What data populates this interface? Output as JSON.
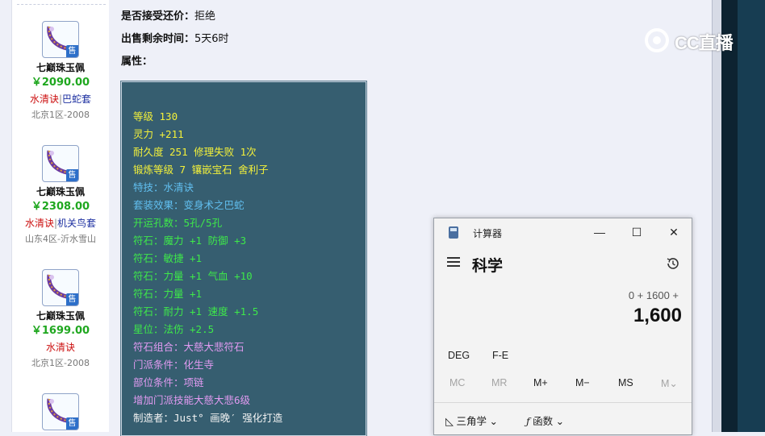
{
  "sidebar": {
    "items": [
      {
        "name": "七巅珠玉佩",
        "price": "￥2090.00",
        "tag1": "水清诀",
        "sep": "|",
        "tag2": "巴蛇套",
        "server": "北京1区-2008",
        "sell_badge": "售"
      },
      {
        "name": "七巅珠玉佩",
        "price": "￥2308.00",
        "tag1": "水清诀",
        "sep": "|",
        "tag2": "机关鸟套",
        "server": "山东4区-沂水雪山",
        "sell_badge": "售"
      },
      {
        "name": "七巅珠玉佩",
        "price": "￥1699.00",
        "tag1": "水清诀",
        "sep": "",
        "tag2": "",
        "server": "北京1区-2008",
        "sell_badge": "售"
      },
      {
        "name": "",
        "price": "",
        "tag1": "",
        "sep": "",
        "tag2": "",
        "server": "",
        "sell_badge": "售"
      }
    ]
  },
  "detail": {
    "bargain_label": "是否接受还价：",
    "bargain_value": "拒绝",
    "remaining_label": "出售剩余时间：",
    "remaining_value": "5天6时",
    "attr_label": "属性："
  },
  "attributes": [
    {
      "text": "等级 130",
      "color": "yellow"
    },
    {
      "text": "灵力 +211",
      "color": "yellow"
    },
    {
      "text": "耐久度 251 修理失败 1次",
      "color": "yellow"
    },
    {
      "text": "锻炼等级 7 镶嵌宝石 舍利子",
      "color": "yellow"
    },
    {
      "text": "特技：水清诀",
      "color": "blue"
    },
    {
      "text": "套装效果：变身术之巴蛇",
      "color": "blue"
    },
    {
      "text": "开运孔数：5孔/5孔",
      "color": "green"
    },
    {
      "text": "符石：魔力 +1 防御 +3",
      "color": "green"
    },
    {
      "text": "符石：敏捷 +1",
      "color": "green"
    },
    {
      "text": "符石：力量 +1 气血 +10",
      "color": "green"
    },
    {
      "text": "符石：力量 +1",
      "color": "green"
    },
    {
      "text": "符石：耐力 +1 速度 +1.5",
      "color": "green"
    },
    {
      "text": "星位：法伤 +2.5",
      "color": "green"
    },
    {
      "text": "符石组合：大慈大悲符石",
      "color": "pink"
    },
    {
      "text": "门派条件：化生寺",
      "color": "pink"
    },
    {
      "text": "部位条件：项链",
      "color": "pink"
    },
    {
      "text": "增加门派技能大慈大悲6级",
      "color": "pink"
    },
    {
      "text": "制造者：Just° 画晚′ 强化打造",
      "color": "white"
    }
  ],
  "watermark": {
    "text": "CC直播"
  },
  "calculator": {
    "title": "计算器",
    "mode": "科学",
    "expression": "0 + 1600 +",
    "result": "1,600",
    "deg": "DEG",
    "fe": "F-E",
    "memory": [
      "MC",
      "MR",
      "M+",
      "M−",
      "MS",
      "M⌄"
    ],
    "trig": "三角学",
    "func": "函数",
    "window_buttons": {
      "minimize": "—",
      "maximize": "☐",
      "close": "✕"
    }
  },
  "colors": {
    "attr_bg": "#365e70",
    "yellow": "#f3f03a",
    "blue": "#61bff0",
    "green": "#3ee84a",
    "pink": "#e39bf2",
    "price_green": "#1fa71f"
  }
}
